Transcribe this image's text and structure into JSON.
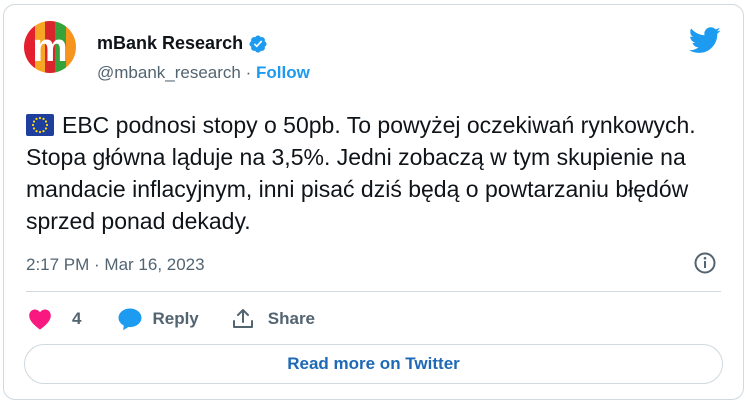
{
  "author": {
    "name": "mBank Research",
    "handle": "@mbank_research",
    "separator": "·",
    "follow_label": "Follow",
    "verified": true
  },
  "avatar": {
    "letter": "m"
  },
  "tweet": {
    "flag_icon": "eu-flag-icon",
    "text": "EBC podnosi stopy o 50pb. To powyżej oczekiwań rynkowych. Stopa główna ląduje na 3,5%. Jedni zobaczą w tym skupienie na mandacie inflacyjnym, inni pisać dziś będą o powtarzaniu błędów sprzed ponad dekady.",
    "timestamp": "2:17 PM · Mar 16, 2023"
  },
  "actions": {
    "like_count": "4",
    "reply_label": "Reply",
    "share_label": "Share"
  },
  "read_more_label": "Read more on Twitter",
  "colors": {
    "twitter_blue": "#1d9bf0",
    "like_pink": "#f91880",
    "text_gray": "#536471",
    "border": "#cfd9de"
  }
}
